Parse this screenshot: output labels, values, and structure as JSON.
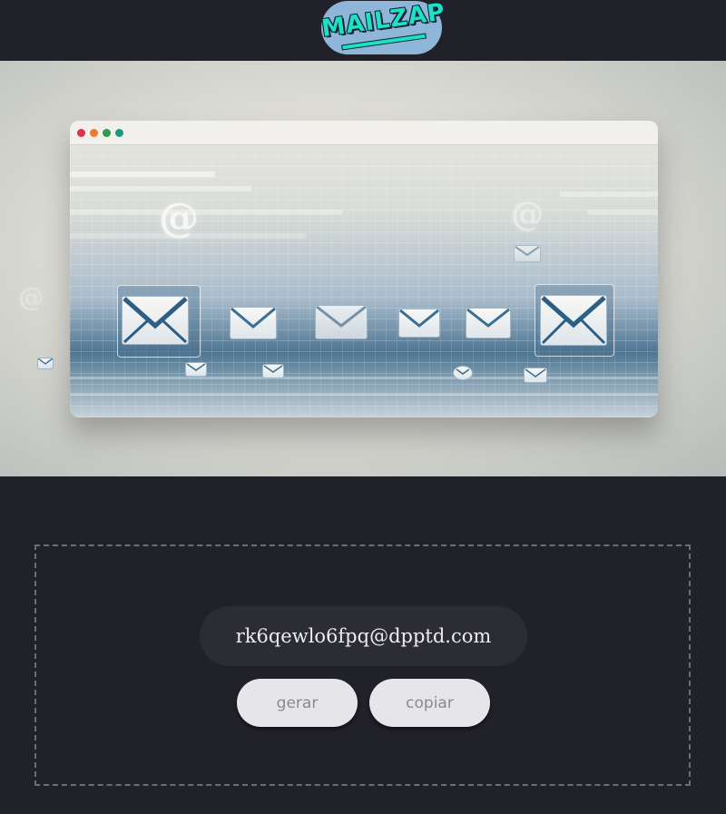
{
  "header": {
    "logo_text": "MAILZAP",
    "colors": {
      "background": "#212129",
      "logo_bg": "#8fb5d8",
      "logo_text": "#1ee0c2"
    }
  },
  "hero": {
    "icons": [
      "at-icon",
      "envelope-icon"
    ]
  },
  "generator": {
    "email": "rk6qewlo6fpq@dpptd.com",
    "generate_label": "gerar",
    "copy_label": "copiar"
  }
}
